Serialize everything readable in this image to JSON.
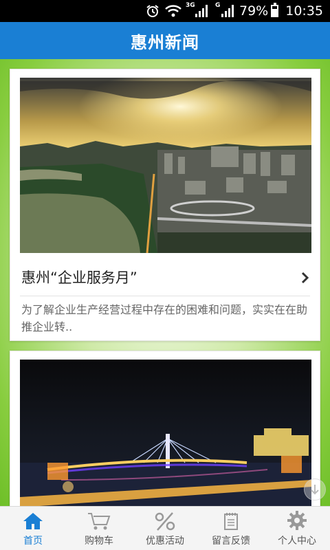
{
  "status_bar": {
    "network_3g": "3G",
    "network_g": "G",
    "battery": "79%",
    "time": "10:35"
  },
  "header": {
    "title": "惠州新闻"
  },
  "news": [
    {
      "title": "惠州“企业服务月”",
      "summary": "为了解企业生产经营过程中存在的困难和问题，实实在在助推企业转.."
    }
  ],
  "bottom_nav": [
    {
      "label": "首页",
      "icon": "home-icon",
      "active": true
    },
    {
      "label": "购物车",
      "icon": "cart-icon",
      "active": false
    },
    {
      "label": "优惠活动",
      "icon": "percent-icon",
      "active": false
    },
    {
      "label": "留言反馈",
      "icon": "notepad-icon",
      "active": false
    },
    {
      "label": "个人中心",
      "icon": "gear-icon",
      "active": false
    }
  ],
  "colors": {
    "header": "#1a7fd4",
    "background": "#8fd248",
    "active_nav": "#1a7fd4"
  }
}
